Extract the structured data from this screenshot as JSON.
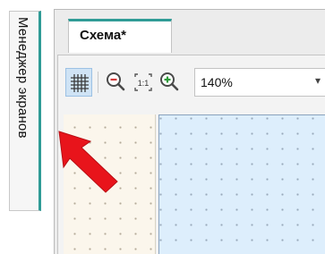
{
  "dock": {
    "screen_manager_label": "Менеджер экранов"
  },
  "document": {
    "tab_label": "Схема*"
  },
  "toolbar": {
    "grid_icon": "grid-icon",
    "zoom_out_icon": "zoom-out-icon",
    "actual_size_icon": "actual-size-icon",
    "actual_size_text": "1:1",
    "zoom_in_icon": "zoom-in-icon",
    "zoom_value": "140%"
  },
  "colors": {
    "accent": "#2f9b96",
    "arrow": "#e8141b",
    "canvas": "#ddeefc",
    "palette": "#fbf6ec"
  }
}
